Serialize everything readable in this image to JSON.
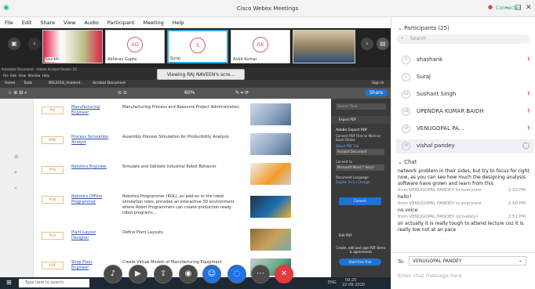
{
  "window": {
    "title": "Cisco Webex Meetings",
    "connection": "Connected"
  },
  "menu": [
    "File",
    "Edit",
    "Share",
    "View",
    "Audio",
    "Participant",
    "Meeting",
    "Help"
  ],
  "video_tiles": [
    {
      "name": "Saurbh"
    },
    {
      "initials": "AG",
      "name": "Abhinav Gupta"
    },
    {
      "initials": "S",
      "name": "Suraj"
    },
    {
      "initials": "AK",
      "name": "Ankit Kumar"
    },
    {
      "name": ""
    }
  ],
  "share_banner": "Viewing RAJ NAVEEN's scre...",
  "acrobat": {
    "window_title": "Autodesk Document - Adobe Acrobat Reader DC",
    "menu": [
      "File",
      "Edit",
      "View",
      "Window",
      "Help"
    ],
    "tabs": [
      "Home",
      "Tools",
      "BSL2018_Acadent...",
      "Acrobat Document"
    ],
    "signin": "Sign In",
    "share": "Share",
    "zoom": "60%",
    "search_tools": "Search Tools",
    "rows": [
      {
        "code": "PSI",
        "link": "Manufacturing Engineer",
        "desc": "Manufacturing Process and Resource Project Administration"
      },
      {
        "code": "MAE",
        "link": "Process Simulation Analyst",
        "desc": "Assembly Process Simulation for Producibility Analysis"
      },
      {
        "code": "RTS",
        "link": "Robotics Engineer",
        "desc": "Simulate and Validate Industrial Robot Behavior"
      },
      {
        "code": "ROE",
        "link": "Robotics Offline Programmer",
        "desc": "Robotics Programmer (ROL), an add-on to the robot simulation roles, provides an interactive 3D environment where Robot Programmers can create production ready robot programs..."
      },
      {
        "code": "PLA",
        "link": "Plant Layout Designer",
        "desc": "Define Plant Layouts"
      },
      {
        "code": "FOE",
        "link": "Shop Floor Engineer",
        "desc": "Create Virtual Models of Manufacturing Equipment"
      }
    ],
    "right_pane": {
      "export_pdf": "Export PDF",
      "heading": "Adobe Export PDF",
      "subtitle": "Convert PDF Files to Word or Excel Online",
      "select": "Select PDF File",
      "file": "Acrobat Document",
      "convert_to_label": "Convert to",
      "convert_to": "Microsoft Word (*.docx)",
      "lang_label": "Document Language:",
      "lang": "English (U.S.) Change",
      "convert_button": "Convert",
      "edit_pdf": "Edit PDF",
      "promo": "Create, edit and sign PDF forms & agreements",
      "trial": "Start Free Trial"
    }
  },
  "taskbar": {
    "search": "Type here to search",
    "time": "09:20",
    "date": "22-06-2020",
    "lang": "ENG"
  },
  "participants": {
    "header": "Participants (25)",
    "search_placeholder": "Search",
    "list": [
      {
        "initials": "S",
        "name": "shashank"
      },
      {
        "initials": "S",
        "name": "Suraj"
      },
      {
        "initials": "SS",
        "name": "Sushant Singh"
      },
      {
        "initials": "UB",
        "name": "UPENDRA KUMAR BAIDH"
      },
      {
        "initials": "VP",
        "name": "VENUGOPAL PA..."
      },
      {
        "initials": "VP",
        "name": "vishal pandey"
      }
    ]
  },
  "chat": {
    "header": "Chat",
    "messages": [
      {
        "kind": "line",
        "text": "network problem in their sides, but try to focus for right"
      },
      {
        "kind": "line",
        "text": "now, as you can see how much the designing analysis"
      },
      {
        "kind": "line",
        "text": "software have grown and learn from this"
      },
      {
        "kind": "from",
        "text": "from VENUGOPAL PANDEY to everyone",
        "time": "2:50 PM"
      },
      {
        "kind": "line",
        "text": "hello?"
      },
      {
        "kind": "from",
        "text": "from VENUGOPAL PANDEY to everyone",
        "time": "2:50 PM"
      },
      {
        "kind": "line",
        "text": "no voice"
      },
      {
        "kind": "from",
        "text": "from VENUGOPAL PANDEY (privately)",
        "time": "2:51 PM"
      },
      {
        "kind": "line",
        "text": "sir actually it is really tough to attend lecture coz it is"
      },
      {
        "kind": "line",
        "text": "really low not at an pace"
      }
    ],
    "to_label": "To:",
    "to_value": "VENUGOPAL PANDEY",
    "input_placeholder": "Enter chat message here"
  },
  "colors": {
    "accent": "#1a73e8",
    "mute": "#e05050",
    "leave": "#e23b3b",
    "share_blue": "#1b75d0"
  }
}
